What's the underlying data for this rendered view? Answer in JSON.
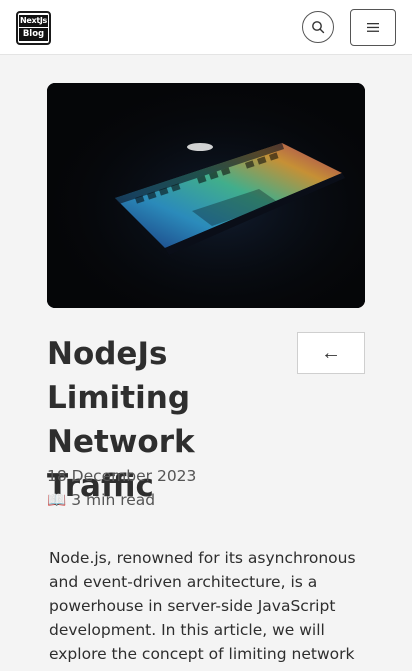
{
  "header": {
    "logo_line1": "NextJs",
    "logo_line2": "Blog"
  },
  "icons": {
    "search": "search-icon",
    "menu": "hamburger-icon",
    "back": "arrow-left"
  },
  "post": {
    "title": "NodeJs Limiting Network Traffic",
    "back_label": "←",
    "date": "18 December 2023",
    "read_icon": "📖",
    "read_time": "3 min read",
    "intro": "Node.js, renowned for its asynchronous and event-driven architecture, is a powerhouse in server-side JavaScript development. In this article, we will explore the concept of limiting network traffic in Node.js"
  },
  "colors": {
    "accent_gradient": [
      "#2f6bd8",
      "#3fbf9a",
      "#e0a23a",
      "#c23a8a"
    ]
  }
}
